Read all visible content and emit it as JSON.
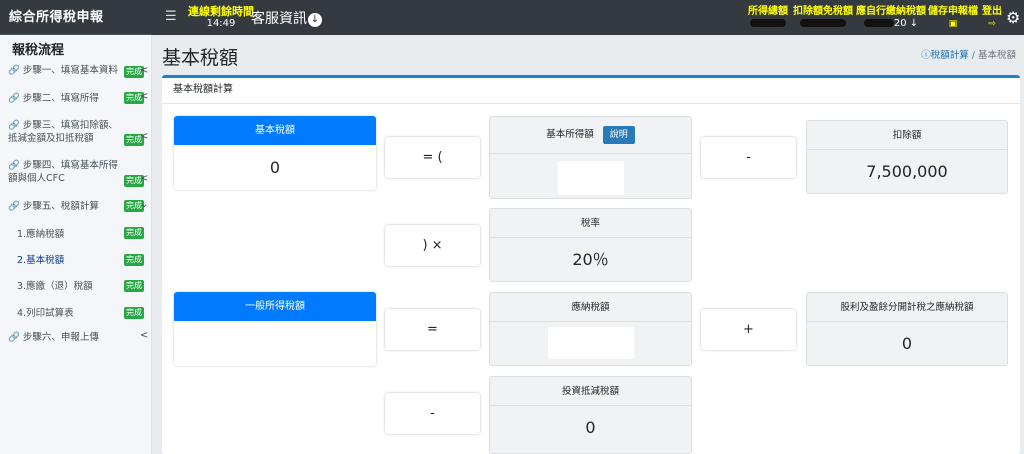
{
  "app": {
    "title": "綜合所得稅申報"
  },
  "topbar": {
    "menu_icon": "hamburger-icon",
    "timer_label": "連線剩餘時間",
    "timer_value": "14:49",
    "customer_service": "客服資訊",
    "nav": [
      {
        "label": "所得總額",
        "value": ""
      },
      {
        "label": "扣除額免稅額",
        "value": ""
      },
      {
        "label": "應自行繳納稅額",
        "value": "20"
      },
      {
        "label": "儲存申報檔",
        "value": ""
      },
      {
        "label": "登出",
        "value": ""
      }
    ]
  },
  "sidebar": {
    "title": "報稅流程",
    "items": [
      {
        "label": "步驟一、填寫基本資料",
        "badge": "完成"
      },
      {
        "label": "步驟二、填寫所得",
        "badge": "完成"
      },
      {
        "label": "步驟三、填寫扣除額、抵減金額及扣抵稅額",
        "badge": "完成"
      },
      {
        "label": "步驟四、填寫基本所得額與個人CFC",
        "badge": "完成"
      },
      {
        "label": "步驟五、稅額計算",
        "badge": "完成"
      },
      {
        "label": "步驟六、申報上傳",
        "badge": ""
      }
    ],
    "subitems": [
      {
        "label": "1.應納稅額",
        "badge": "完成"
      },
      {
        "label": "2.基本稅額",
        "badge": "完成"
      },
      {
        "label": "3.應繳（退）稅額",
        "badge": "完成"
      },
      {
        "label": "4.列印試算表",
        "badge": "完成"
      }
    ]
  },
  "page": {
    "title": "基本稅額",
    "breadcrumb": [
      "稅額計算",
      "基本稅額"
    ],
    "card_title": "基本稅額計算"
  },
  "calc": {
    "basic_tax": {
      "label": "基本稅額",
      "value": "0"
    },
    "op_eq_paren": "= (",
    "basic_income": {
      "label": "基本所得額",
      "button": "說明"
    },
    "op_minus1": "-",
    "deduction": {
      "label": "扣除額",
      "value": "7,500,000"
    },
    "op_close_times": ") ×",
    "tax_rate": {
      "label": "稅率",
      "value": "20％"
    },
    "general_tax": {
      "label": "一般所得稅額",
      "value": ""
    },
    "op_eq2": "=",
    "payable_tax": {
      "label": "應納稅額"
    },
    "op_plus": "+",
    "dividend_tax": {
      "label": "股利及盈餘分開計稅之應納稅額",
      "value": "0"
    },
    "op_minus2": "-",
    "investment_credit": {
      "label": "投資抵減稅額",
      "value": "0"
    }
  }
}
